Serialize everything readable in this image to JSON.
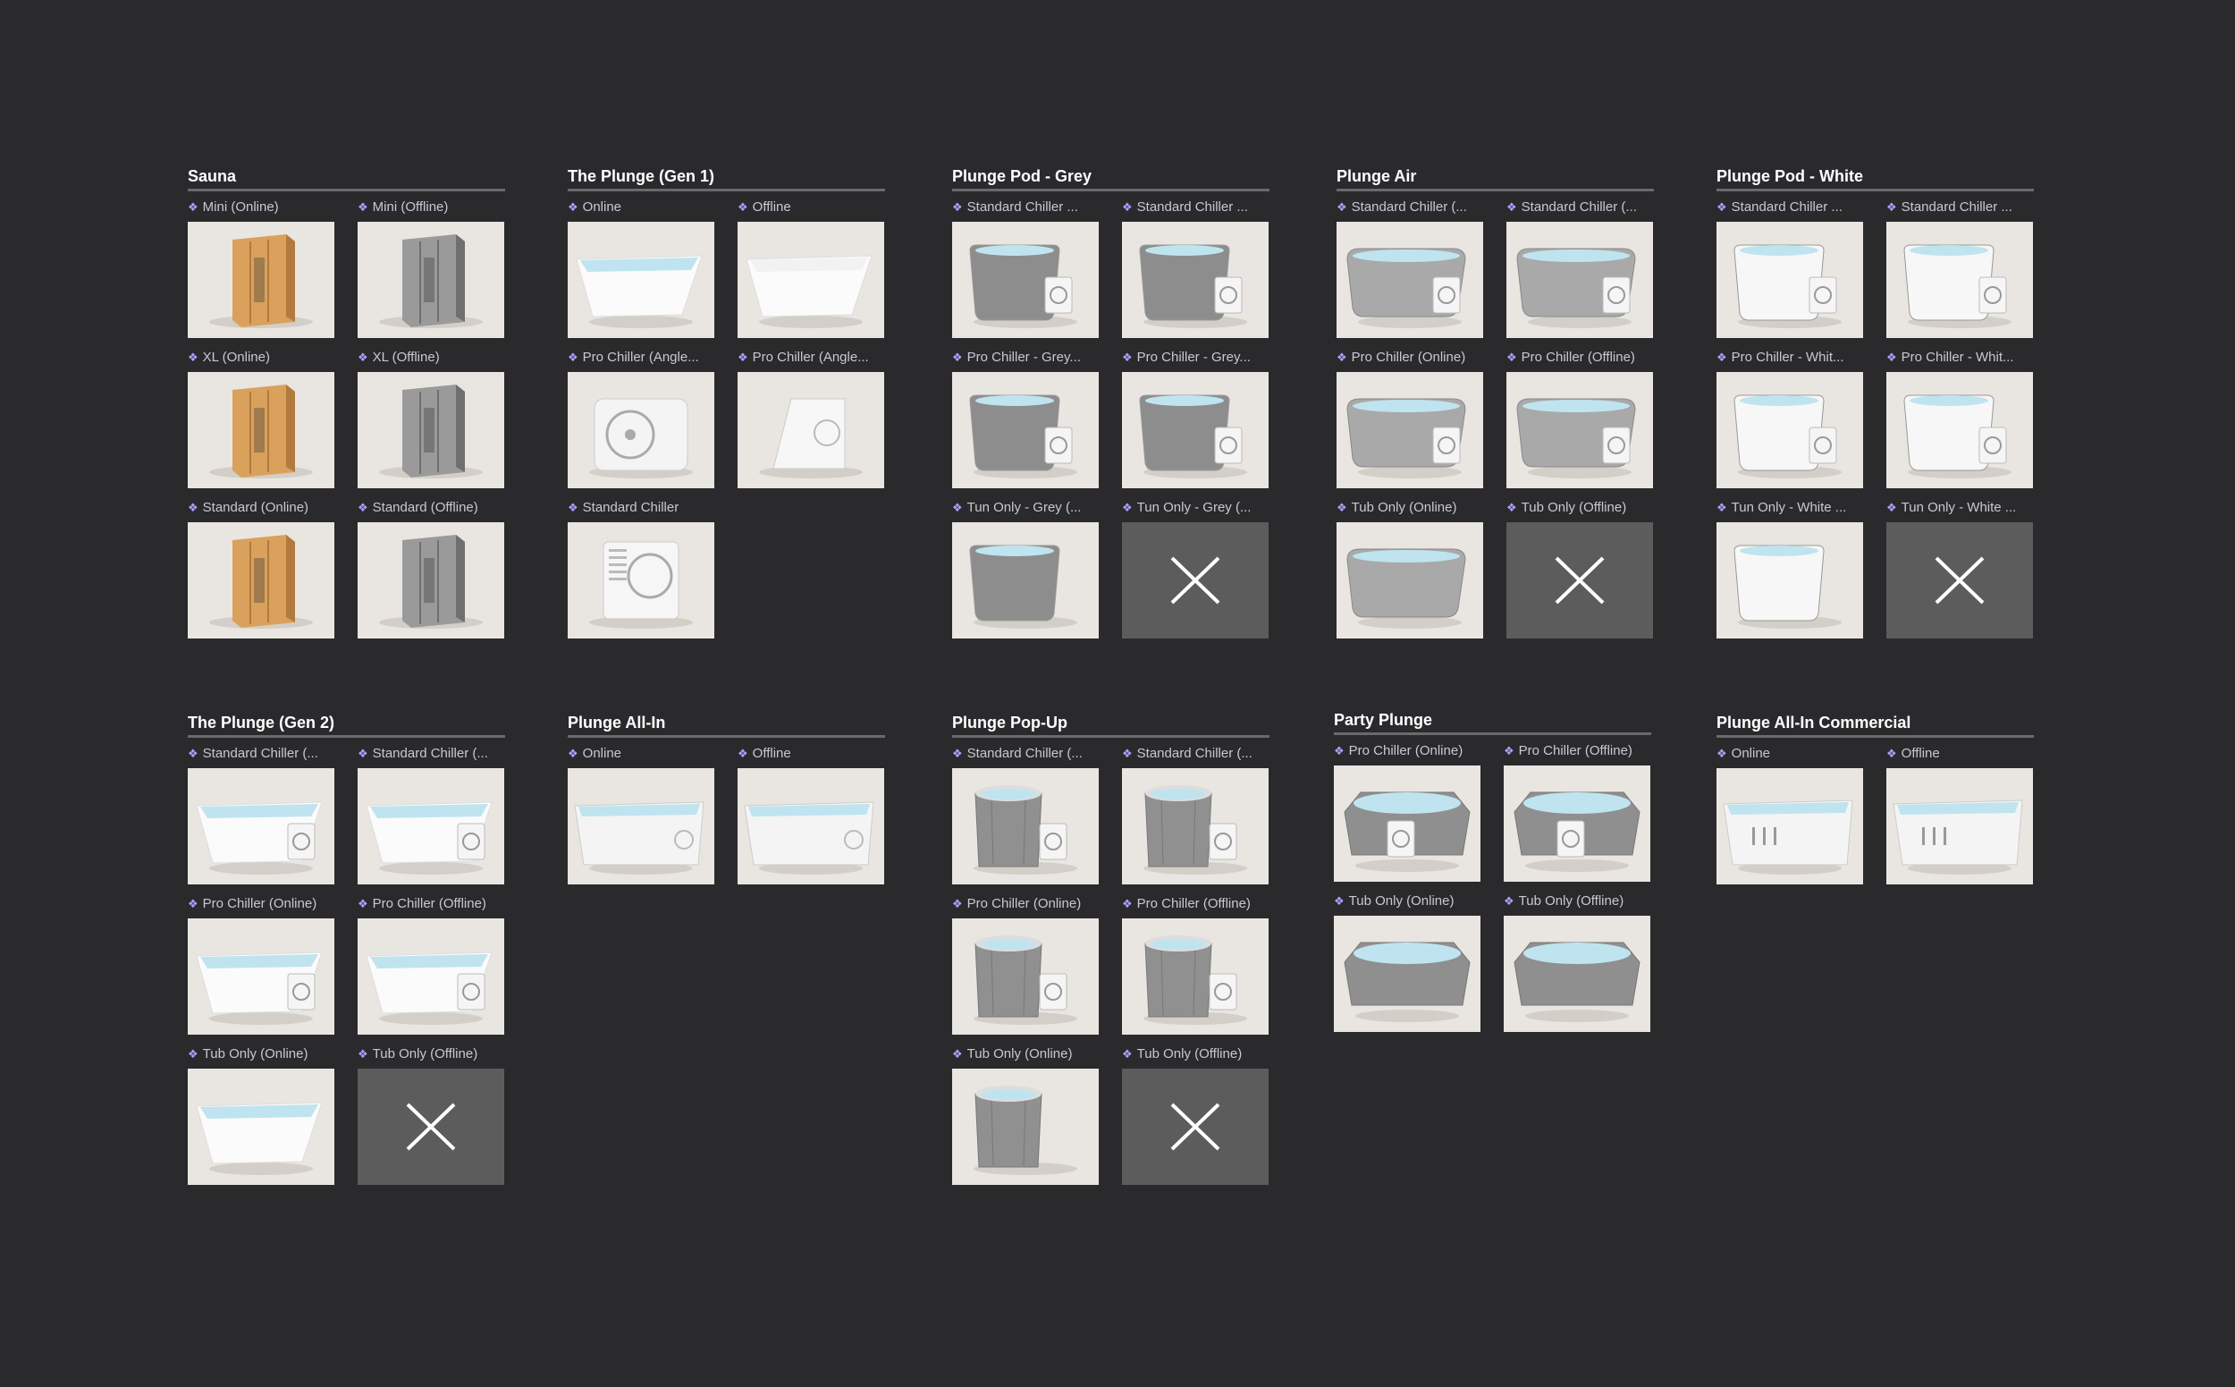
{
  "groups": [
    {
      "title": "Sauna",
      "cards": [
        {
          "label": "Mini (Online)",
          "icon": "sauna-wood-icon"
        },
        {
          "label": "Mini (Offline)",
          "icon": "sauna-grey-icon"
        },
        {
          "label": "XL (Online)",
          "icon": "sauna-wood-icon"
        },
        {
          "label": "XL (Offline)",
          "icon": "sauna-grey-icon"
        },
        {
          "label": "Standard (Online)",
          "icon": "sauna-wood-icon"
        },
        {
          "label": "Standard (Offline)",
          "icon": "sauna-grey-icon"
        }
      ]
    },
    {
      "title": "The Plunge (Gen 1)",
      "cards": [
        {
          "label": "Online",
          "icon": "tub-white-icon"
        },
        {
          "label": "Offline",
          "icon": "tub-white-empty-icon"
        },
        {
          "label": "Pro Chiller (Angle...",
          "icon": "chiller-box-icon"
        },
        {
          "label": "Pro Chiller (Angle...",
          "icon": "chiller-wedge-icon"
        },
        {
          "label": "Standard Chiller",
          "icon": "chiller-fan-icon"
        }
      ]
    },
    {
      "title": "Plunge Pod - Grey",
      "cards": [
        {
          "label": "Standard Chiller ...",
          "icon": "pod-grey-chiller-icon"
        },
        {
          "label": "Standard Chiller ...",
          "icon": "pod-grey-chiller-icon"
        },
        {
          "label": "Pro Chiller - Grey...",
          "icon": "pod-grey-chiller-icon"
        },
        {
          "label": "Pro Chiller - Grey...",
          "icon": "pod-grey-chiller-icon"
        },
        {
          "label": "Tun Only - Grey (...",
          "icon": "pod-grey-icon"
        },
        {
          "label": "Tun Only - Grey (...",
          "icon": "unavailable-x-icon"
        }
      ]
    },
    {
      "title": "Plunge Air",
      "cards": [
        {
          "label": "Standard Chiller (...",
          "icon": "air-tub-chiller-icon"
        },
        {
          "label": "Standard Chiller (...",
          "icon": "air-tub-chiller-icon"
        },
        {
          "label": "Pro Chiller (Online)",
          "icon": "air-tub-chiller-icon"
        },
        {
          "label": "Pro Chiller (Offline)",
          "icon": "air-tub-chiller-icon"
        },
        {
          "label": "Tub Only (Online)",
          "icon": "air-tub-icon"
        },
        {
          "label": "Tub Only (Offline)",
          "icon": "unavailable-x-icon"
        }
      ]
    },
    {
      "title": "Plunge Pod - White",
      "cards": [
        {
          "label": "Standard Chiller ...",
          "icon": "pod-white-chiller-icon"
        },
        {
          "label": "Standard Chiller ...",
          "icon": "pod-white-chiller-icon"
        },
        {
          "label": "Pro Chiller - Whit...",
          "icon": "pod-white-chiller-icon"
        },
        {
          "label": "Pro Chiller - Whit...",
          "icon": "pod-white-chiller-icon"
        },
        {
          "label": "Tun Only - White ...",
          "icon": "pod-white-icon"
        },
        {
          "label": "Tun Only - White ...",
          "icon": "unavailable-x-icon"
        }
      ]
    },
    {
      "title": "The Plunge (Gen 2)",
      "cards": [
        {
          "label": "Standard Chiller (...",
          "icon": "tub-white-chiller-icon"
        },
        {
          "label": "Standard Chiller (...",
          "icon": "tub-white-chiller-icon"
        },
        {
          "label": "Pro Chiller (Online)",
          "icon": "tub-white-chiller-icon"
        },
        {
          "label": "Pro Chiller (Offline)",
          "icon": "tub-white-chiller-icon"
        },
        {
          "label": "Tub Only (Online)",
          "icon": "tub-white-icon"
        },
        {
          "label": "Tub Only (Offline)",
          "icon": "unavailable-x-icon"
        }
      ]
    },
    {
      "title": "Plunge All-In",
      "cards": [
        {
          "label": "Online",
          "icon": "allin-tub-icon"
        },
        {
          "label": "Offline",
          "icon": "allin-tub-icon"
        }
      ]
    },
    {
      "title": "Plunge Pop-Up",
      "cards": [
        {
          "label": "Standard Chiller (...",
          "icon": "popup-chiller-icon"
        },
        {
          "label": "Standard Chiller (...",
          "icon": "popup-chiller-icon"
        },
        {
          "label": "Pro Chiller (Online)",
          "icon": "popup-chiller-icon"
        },
        {
          "label": "Pro Chiller (Offline)",
          "icon": "popup-chiller-icon"
        },
        {
          "label": "Tub Only (Online)",
          "icon": "popup-tub-icon"
        },
        {
          "label": "Tub Only (Offline)",
          "icon": "unavailable-x-icon"
        }
      ]
    },
    {
      "title": "Party Plunge",
      "cards": [
        {
          "label": "Pro Chiller (Online)",
          "icon": "party-tub-chiller-icon"
        },
        {
          "label": "Pro Chiller (Offline)",
          "icon": "party-tub-chiller-icon"
        },
        {
          "label": "Tub Only (Online)",
          "icon": "party-tub-icon"
        },
        {
          "label": "Tub Only (Offline)",
          "icon": "party-tub-icon"
        }
      ]
    },
    {
      "title": "Plunge All-In Commercial",
      "cards": [
        {
          "label": "Online",
          "icon": "commercial-tub-icon"
        },
        {
          "label": "Offline",
          "icon": "commercial-tub-icon"
        }
      ]
    }
  ]
}
